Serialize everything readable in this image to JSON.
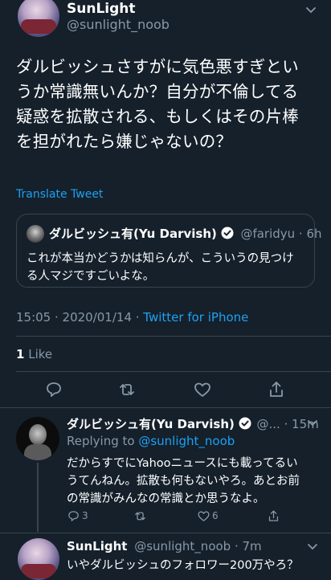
{
  "tweet": {
    "author_name": "SunLight",
    "author_handle": "@sunlight_noob",
    "body_lines": [
      "ダルビッシュさすがに気色悪すぎとい",
      "うか常識無いんか？自分が不倫してる",
      "疑惑を拡散される、もしくはその片棒",
      "を担がれたら嫌じゃないの？"
    ],
    "translate_label": "Translate Tweet",
    "timestamp": "15:05 · 2020/01/14 · ",
    "source": "Twitter for iPhone",
    "like_count": "1",
    "like_label": " Like"
  },
  "quoted": {
    "author_name": "ダルビッシュ有(Yu Darvish)",
    "handle_time": "@faridyu · 6h",
    "body_lines": [
      "これが本当かどうかは知らんが、こういうの見つけ",
      "る人マジですごいよな。"
    ]
  },
  "reply1": {
    "author_name": "ダルビッシュ有(Yu Darvish)",
    "handle_time": "@... · 15m",
    "replying_prefix": "Replying to ",
    "replying_handle": "@sunlight_noob",
    "body_lines": [
      "だからすでにYahooニュースにも載ってるい",
      "うてんねん。拡散も何もないやろ。あとお前",
      "の常識がみんなの常識とか思うなよ。"
    ],
    "reply_count": "3",
    "like_count": "6"
  },
  "reply2": {
    "author_name": "SunLight",
    "handle_time": "@sunlight_noob · 7m",
    "body_line": "いやダルビッシュのフォロワー200万やろ？"
  },
  "colors": {
    "background": "#15202b",
    "accent": "#1da1f2",
    "muted": "#8899a6",
    "divider": "#38444d"
  }
}
